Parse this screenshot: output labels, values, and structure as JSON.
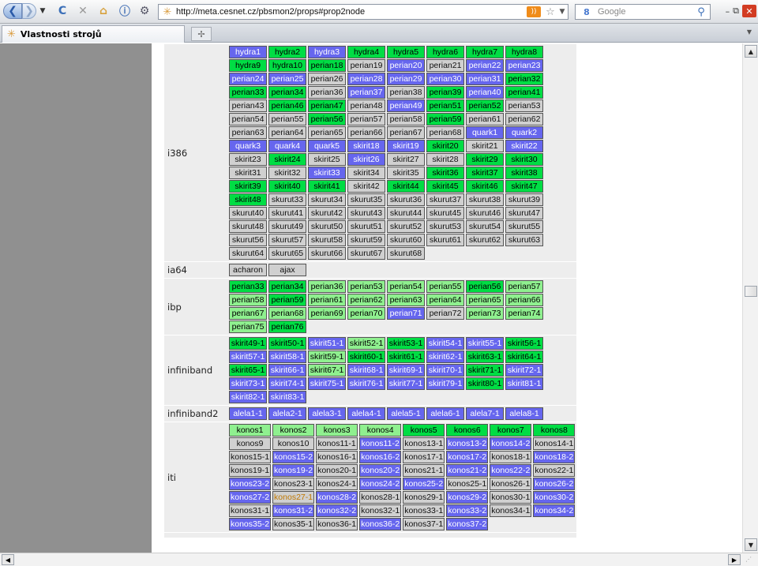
{
  "browser": {
    "url": "http://meta.cesnet.cz/pbsmon2/props#prop2node",
    "search_placeholder": "Google",
    "tab_title": "Vlastnosti strojů",
    "back_glyph": "❮",
    "fwd_glyph": "❯",
    "reload_glyph": "C",
    "stop_glyph": "✕",
    "home_glyph": "⌂",
    "info_glyph": "ⓘ",
    "search_engine_glyph": "8",
    "search_glyph": "⚲",
    "new_tab_glyph": "✢",
    "rss_glyph": "))",
    "star_glyph": "☆",
    "dropdown_glyph": "▼",
    "minimize_glyph": "–",
    "restore_glyph": "⧉",
    "close_glyph": "✕",
    "tab_icon": "✳",
    "colors": {
      "free": "#00dd44",
      "partial": "#8ff08f",
      "busy": "#6666ee",
      "down": "#d0d0d0",
      "running_text": "#c07800",
      "side_panel": "#909090"
    }
  },
  "groups": [
    {
      "label": "i386",
      "rows": [
        [
          [
            "hydra1",
            "busy"
          ],
          [
            "hydra2",
            "free"
          ],
          [
            "hydra3",
            "busy"
          ],
          [
            "hydra4",
            "free"
          ],
          [
            "hydra5",
            "free"
          ],
          [
            "hydra6",
            "free"
          ],
          [
            "hydra7",
            "free"
          ],
          [
            "hydra8",
            "free"
          ]
        ],
        [
          [
            "hydra9",
            "free"
          ],
          [
            "hydra10",
            "free"
          ],
          [
            "perian18",
            "free"
          ],
          [
            "perian19",
            "down"
          ],
          [
            "perian20",
            "busy"
          ],
          [
            "perian21",
            "down"
          ],
          [
            "perian22",
            "busy"
          ],
          [
            "perian23",
            "busy"
          ]
        ],
        [
          [
            "perian24",
            "busy"
          ],
          [
            "perian25",
            "busy"
          ],
          [
            "perian26",
            "down"
          ],
          [
            "perian28",
            "busy"
          ],
          [
            "perian29",
            "busy"
          ],
          [
            "perian30",
            "busy"
          ],
          [
            "perian31",
            "busy"
          ],
          [
            "perian32",
            "free"
          ]
        ],
        [
          [
            "perian33",
            "free"
          ],
          [
            "perian34",
            "free"
          ],
          [
            "perian36",
            "down"
          ],
          [
            "perian37",
            "busy"
          ],
          [
            "perian38",
            "down"
          ],
          [
            "perian39",
            "free"
          ],
          [
            "perian40",
            "busy"
          ],
          [
            "perian41",
            "free"
          ]
        ],
        [
          [
            "perian43",
            "down"
          ],
          [
            "perian46",
            "free"
          ],
          [
            "perian47",
            "free"
          ],
          [
            "perian48",
            "down"
          ],
          [
            "perian49",
            "busy"
          ],
          [
            "perian51",
            "free"
          ],
          [
            "perian52",
            "free"
          ],
          [
            "perian53",
            "down"
          ]
        ],
        [
          [
            "perian54",
            "down"
          ],
          [
            "perian55",
            "down"
          ],
          [
            "perian56",
            "free"
          ],
          [
            "perian57",
            "down"
          ],
          [
            "perian58",
            "down"
          ],
          [
            "perian59",
            "free"
          ],
          [
            "perian61",
            "down"
          ],
          [
            "perian62",
            "down"
          ]
        ],
        [
          [
            "perian63",
            "down"
          ],
          [
            "perian64",
            "down"
          ],
          [
            "perian65",
            "down"
          ],
          [
            "perian66",
            "down"
          ],
          [
            "perian67",
            "down"
          ],
          [
            "perian68",
            "down"
          ],
          [
            "quark1",
            "busy"
          ],
          [
            "quark2",
            "busy"
          ]
        ],
        [
          [
            "quark3",
            "busy"
          ],
          [
            "quark4",
            "busy"
          ],
          [
            "quark5",
            "busy"
          ],
          [
            "skirit18",
            "busy"
          ],
          [
            "skirit19",
            "busy"
          ],
          [
            "skirit20",
            "free"
          ],
          [
            "skirit21",
            "down"
          ],
          [
            "skirit22",
            "busy"
          ]
        ],
        [
          [
            "skirit23",
            "down"
          ],
          [
            "skirit24",
            "free"
          ],
          [
            "skirit25",
            "down"
          ],
          [
            "skirit26",
            "busy"
          ],
          [
            "skirit27",
            "down"
          ],
          [
            "skirit28",
            "down"
          ],
          [
            "skirit29",
            "free"
          ],
          [
            "skirit30",
            "free"
          ]
        ],
        [
          [
            "skirit31",
            "down"
          ],
          [
            "skirit32",
            "down"
          ],
          [
            "skirit33",
            "busy"
          ],
          [
            "skirit34",
            "down"
          ],
          [
            "skirit35",
            "down"
          ],
          [
            "skirit36",
            "free"
          ],
          [
            "skirit37",
            "free"
          ],
          [
            "skirit38",
            "free"
          ]
        ],
        [
          [
            "skirit39",
            "free"
          ],
          [
            "skirit40",
            "free"
          ],
          [
            "skirit41",
            "free"
          ],
          [
            "skirit42",
            "down"
          ],
          [
            "skirit44",
            "free"
          ],
          [
            "skirit45",
            "free"
          ],
          [
            "skirit46",
            "free"
          ],
          [
            "skirit47",
            "free"
          ]
        ],
        [
          [
            "skirit48",
            "free"
          ],
          [
            "skurut33",
            "down"
          ],
          [
            "skurut34",
            "down"
          ],
          [
            "skurut35",
            "down"
          ],
          [
            "skurut36",
            "down"
          ],
          [
            "skurut37",
            "down"
          ],
          [
            "skurut38",
            "down"
          ],
          [
            "skurut39",
            "down"
          ]
        ],
        [
          [
            "skurut40",
            "down"
          ],
          [
            "skurut41",
            "down"
          ],
          [
            "skurut42",
            "down"
          ],
          [
            "skurut43",
            "down"
          ],
          [
            "skurut44",
            "down"
          ],
          [
            "skurut45",
            "down"
          ],
          [
            "skurut46",
            "down"
          ],
          [
            "skurut47",
            "down"
          ]
        ],
        [
          [
            "skurut48",
            "down"
          ],
          [
            "skurut49",
            "down"
          ],
          [
            "skurut50",
            "down"
          ],
          [
            "skurut51",
            "down"
          ],
          [
            "skurut52",
            "down"
          ],
          [
            "skurut53",
            "down"
          ],
          [
            "skurut54",
            "down"
          ],
          [
            "skurut55",
            "down"
          ]
        ],
        [
          [
            "skurut56",
            "down"
          ],
          [
            "skurut57",
            "down"
          ],
          [
            "skurut58",
            "down"
          ],
          [
            "skurut59",
            "down"
          ],
          [
            "skurut60",
            "down"
          ],
          [
            "skurut61",
            "down"
          ],
          [
            "skurut62",
            "down"
          ],
          [
            "skurut63",
            "down"
          ]
        ],
        [
          [
            "skurut64",
            "down"
          ],
          [
            "skurut65",
            "down"
          ],
          [
            "skurut66",
            "down"
          ],
          [
            "skurut67",
            "down"
          ],
          [
            "skurut68",
            "down"
          ]
        ]
      ]
    },
    {
      "label": "ia64",
      "rows": [
        [
          [
            "acharon",
            "down"
          ],
          [
            "ajax",
            "down"
          ]
        ]
      ]
    },
    {
      "label": "ibp",
      "rows": [
        [
          [
            "perian33",
            "free"
          ],
          [
            "perian34",
            "free"
          ],
          [
            "perian36",
            "part"
          ],
          [
            "perian53",
            "part"
          ],
          [
            "perian54",
            "part"
          ],
          [
            "perian55",
            "part"
          ],
          [
            "perian56",
            "free"
          ],
          [
            "perian57",
            "part"
          ]
        ],
        [
          [
            "perian58",
            "part"
          ],
          [
            "perian59",
            "free"
          ],
          [
            "perian61",
            "part"
          ],
          [
            "perian62",
            "part"
          ],
          [
            "perian63",
            "part"
          ],
          [
            "perian64",
            "part"
          ],
          [
            "perian65",
            "part"
          ],
          [
            "perian66",
            "part"
          ]
        ],
        [
          [
            "perian67",
            "part"
          ],
          [
            "perian68",
            "part"
          ],
          [
            "perian69",
            "part"
          ],
          [
            "perian70",
            "part"
          ],
          [
            "perian71",
            "busy"
          ],
          [
            "perian72",
            "down"
          ],
          [
            "perian73",
            "part"
          ],
          [
            "perian74",
            "part"
          ]
        ],
        [
          [
            "perian75",
            "part"
          ],
          [
            "perian76",
            "free"
          ]
        ]
      ]
    },
    {
      "label": "infiniband",
      "rows": [
        [
          [
            "skirit49-1",
            "free"
          ],
          [
            "skirit50-1",
            "free"
          ],
          [
            "skirit51-1",
            "busy"
          ],
          [
            "skirit52-1",
            "part"
          ],
          [
            "skirit53-1",
            "free"
          ],
          [
            "skirit54-1",
            "busy"
          ],
          [
            "skirit55-1",
            "busy"
          ],
          [
            "skirit56-1",
            "free"
          ]
        ],
        [
          [
            "skirit57-1",
            "busy"
          ],
          [
            "skirit58-1",
            "busy"
          ],
          [
            "skirit59-1",
            "part"
          ],
          [
            "skirit60-1",
            "free"
          ],
          [
            "skirit61-1",
            "free"
          ],
          [
            "skirit62-1",
            "busy"
          ],
          [
            "skirit63-1",
            "free"
          ],
          [
            "skirit64-1",
            "free"
          ]
        ],
        [
          [
            "skirit65-1",
            "free"
          ],
          [
            "skirit66-1",
            "busy"
          ],
          [
            "skirit67-1",
            "part"
          ],
          [
            "skirit68-1",
            "busy"
          ],
          [
            "skirit69-1",
            "busy"
          ],
          [
            "skirit70-1",
            "busy"
          ],
          [
            "skirit71-1",
            "free"
          ],
          [
            "skirit72-1",
            "busy"
          ]
        ],
        [
          [
            "skirit73-1",
            "busy"
          ],
          [
            "skirit74-1",
            "busy"
          ],
          [
            "skirit75-1",
            "busy"
          ],
          [
            "skirit76-1",
            "busy"
          ],
          [
            "skirit77-1",
            "busy"
          ],
          [
            "skirit79-1",
            "busy"
          ],
          [
            "skirit80-1",
            "free"
          ],
          [
            "skirit81-1",
            "busy"
          ]
        ],
        [
          [
            "skirit82-1",
            "busy"
          ],
          [
            "skirit83-1",
            "busy"
          ]
        ]
      ]
    },
    {
      "label": "infiniband2",
      "rows": [
        [
          [
            "alela1-1",
            "busy"
          ],
          [
            "alela2-1",
            "busy"
          ],
          [
            "alela3-1",
            "busy"
          ],
          [
            "alela4-1",
            "busy"
          ],
          [
            "alela5-1",
            "busy"
          ],
          [
            "alela6-1",
            "busy"
          ],
          [
            "alela7-1",
            "busy"
          ],
          [
            "alela8-1",
            "busy"
          ]
        ]
      ]
    },
    {
      "label": "iti",
      "rows": [
        [
          [
            "konos1",
            "part"
          ],
          [
            "konos2",
            "part"
          ],
          [
            "konos3",
            "part"
          ],
          [
            "konos4",
            "part"
          ],
          [
            "konos5",
            "free"
          ],
          [
            "konos6",
            "free"
          ],
          [
            "konos7",
            "free"
          ],
          [
            "konos8",
            "free"
          ]
        ],
        [
          [
            "konos9",
            "down"
          ],
          [
            "konos10",
            "down"
          ],
          [
            "konos11-1",
            "down"
          ],
          [
            "konos11-2",
            "busy"
          ],
          [
            "konos13-1",
            "down"
          ],
          [
            "konos13-2",
            "busy"
          ],
          [
            "konos14-2",
            "busy"
          ],
          [
            "konos14-1",
            "down"
          ]
        ],
        [
          [
            "konos15-1",
            "down"
          ],
          [
            "konos15-2",
            "busy"
          ],
          [
            "konos16-1",
            "down"
          ],
          [
            "konos16-2",
            "busy"
          ],
          [
            "konos17-1",
            "down"
          ],
          [
            "konos17-2",
            "busy"
          ],
          [
            "konos18-1",
            "down"
          ],
          [
            "konos18-2",
            "busy"
          ]
        ],
        [
          [
            "konos19-1",
            "down"
          ],
          [
            "konos19-2",
            "busy"
          ],
          [
            "konos20-1",
            "down"
          ],
          [
            "konos20-2",
            "busy"
          ],
          [
            "konos21-1",
            "down"
          ],
          [
            "konos21-2",
            "busy"
          ],
          [
            "konos22-2",
            "busy"
          ],
          [
            "konos22-1",
            "down"
          ]
        ],
        [
          [
            "konos23-2",
            "busy"
          ],
          [
            "konos23-1",
            "down"
          ],
          [
            "konos24-1",
            "down"
          ],
          [
            "konos24-2",
            "busy"
          ],
          [
            "konos25-2",
            "busy"
          ],
          [
            "konos25-1",
            "down"
          ],
          [
            "konos26-1",
            "down"
          ],
          [
            "konos26-2",
            "busy"
          ]
        ],
        [
          [
            "konos27-2",
            "busy"
          ],
          [
            "konos27-1",
            "run"
          ],
          [
            "konos28-2",
            "busy"
          ],
          [
            "konos28-1",
            "down"
          ],
          [
            "konos29-1",
            "down"
          ],
          [
            "konos29-2",
            "busy"
          ],
          [
            "konos30-1",
            "down"
          ],
          [
            "konos30-2",
            "busy"
          ]
        ],
        [
          [
            "konos31-1",
            "down"
          ],
          [
            "konos31-2",
            "busy"
          ],
          [
            "konos32-2",
            "busy"
          ],
          [
            "konos32-1",
            "down"
          ],
          [
            "konos33-1",
            "down"
          ],
          [
            "konos33-2",
            "busy"
          ],
          [
            "konos34-1",
            "down"
          ],
          [
            "konos34-2",
            "busy"
          ]
        ],
        [
          [
            "konos35-2",
            "busy"
          ],
          [
            "konos35-1",
            "down"
          ],
          [
            "konos36-1",
            "down"
          ],
          [
            "konos36-2",
            "busy"
          ],
          [
            "konos37-1",
            "down"
          ],
          [
            "konos37-2",
            "busy"
          ]
        ]
      ]
    }
  ]
}
